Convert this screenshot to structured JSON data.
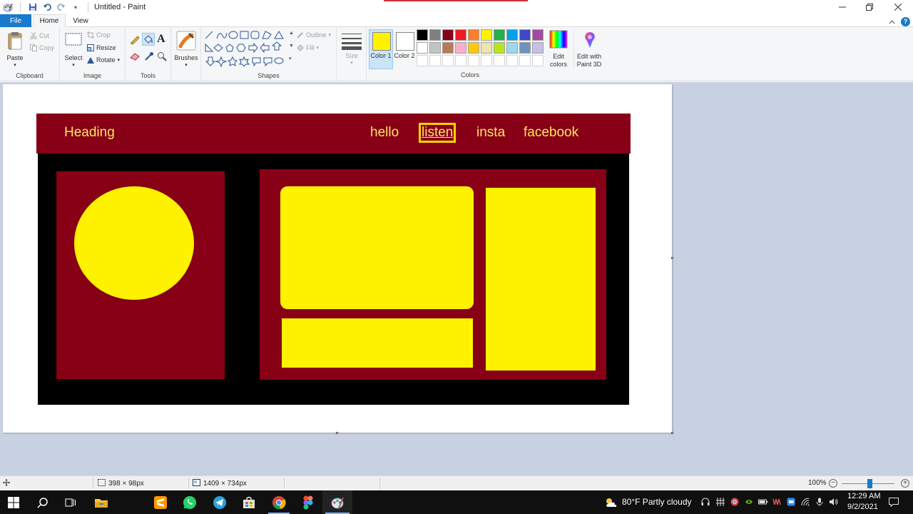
{
  "window": {
    "title": "Untitled - Paint"
  },
  "ribbon_tabs": {
    "file": "File",
    "home": "Home",
    "view": "View"
  },
  "clipboard": {
    "paste": "Paste",
    "cut": "Cut",
    "copy": "Copy",
    "label": "Clipboard"
  },
  "image_group": {
    "select": "Select",
    "crop": "Crop",
    "resize": "Resize",
    "rotate": "Rotate",
    "label": "Image"
  },
  "tools_group": {
    "label": "Tools"
  },
  "brushes": {
    "label": "Brushes"
  },
  "shapes_group": {
    "outline": "Outline",
    "fill": "Fill",
    "label": "Shapes"
  },
  "size": {
    "label": "Size"
  },
  "colors_group": {
    "color1": "Color 1",
    "color2": "Color 2",
    "edit_colors": "Edit colors",
    "edit_3d": "Edit with Paint 3D",
    "label": "Colors",
    "color1_value": "#fff200",
    "color2_value": "#ffffff",
    "palette_row1": [
      "#000000",
      "#7f7f7f",
      "#880015",
      "#ed1c24",
      "#ff7f27",
      "#fff200",
      "#22b14c",
      "#00a2e8",
      "#3f48cc",
      "#a349a4"
    ],
    "palette_row2": [
      "#ffffff",
      "#c3c3c3",
      "#b97a57",
      "#ffaec9",
      "#ffc90e",
      "#efe4b0",
      "#b5e61d",
      "#99d9ea",
      "#7092be",
      "#c8bfe7"
    ]
  },
  "drawing": {
    "heading": "Heading",
    "links": [
      "hello",
      "listen",
      "insta",
      "facebook"
    ]
  },
  "status": {
    "selection_size": "398 × 98px",
    "image_size": "1409 × 734px",
    "zoom": "100%"
  },
  "taskbar": {
    "weather": "80°F  Partly cloudy",
    "time": "12:29 AM",
    "date": "9/2/2021"
  }
}
